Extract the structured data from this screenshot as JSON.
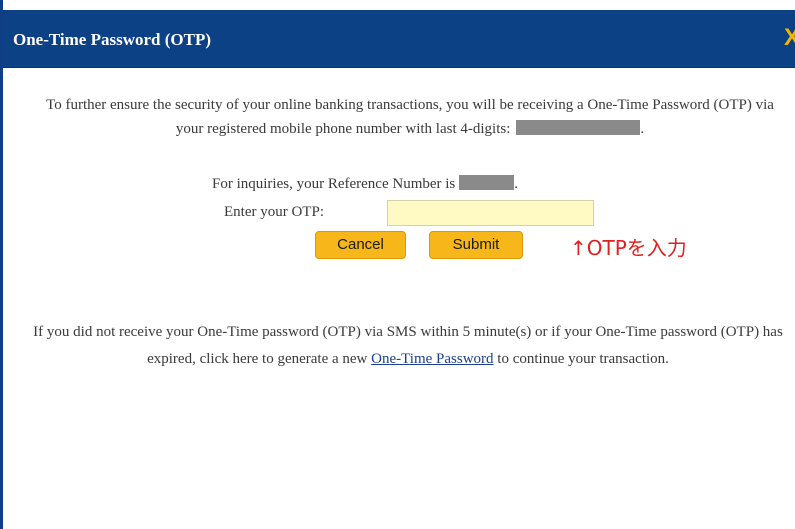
{
  "dialog": {
    "title": "One-Time Password (OTP)",
    "close_glyph": "X"
  },
  "intro": {
    "text": "To further ensure the security of your online banking transactions, you will be receiving a One-Time Password (OTP) via your registered mobile phone number with last 4-digits:",
    "suffix": "."
  },
  "reference": {
    "label": "For inquiries, your Reference Number is",
    "suffix": "."
  },
  "otp": {
    "label": "Enter your OTP:",
    "value": "",
    "placeholder": ""
  },
  "buttons": {
    "cancel": "Cancel",
    "submit": "Submit"
  },
  "annotation": {
    "text": "↑OTPを入力",
    "color": "#e02020"
  },
  "footer": {
    "text_before": "If you did not receive your One-Time password (OTP) via SMS within 5 minute(s) or if your One-Time password (OTP) has expired, click here to generate a new",
    "link": "One-Time Password",
    "text_after": "to continue your transaction."
  },
  "colors": {
    "titlebar": "#0d4185",
    "close": "#f5b400",
    "button": "#f7b61a",
    "input_bg": "#fff9c4",
    "link": "#1c3f8f"
  }
}
